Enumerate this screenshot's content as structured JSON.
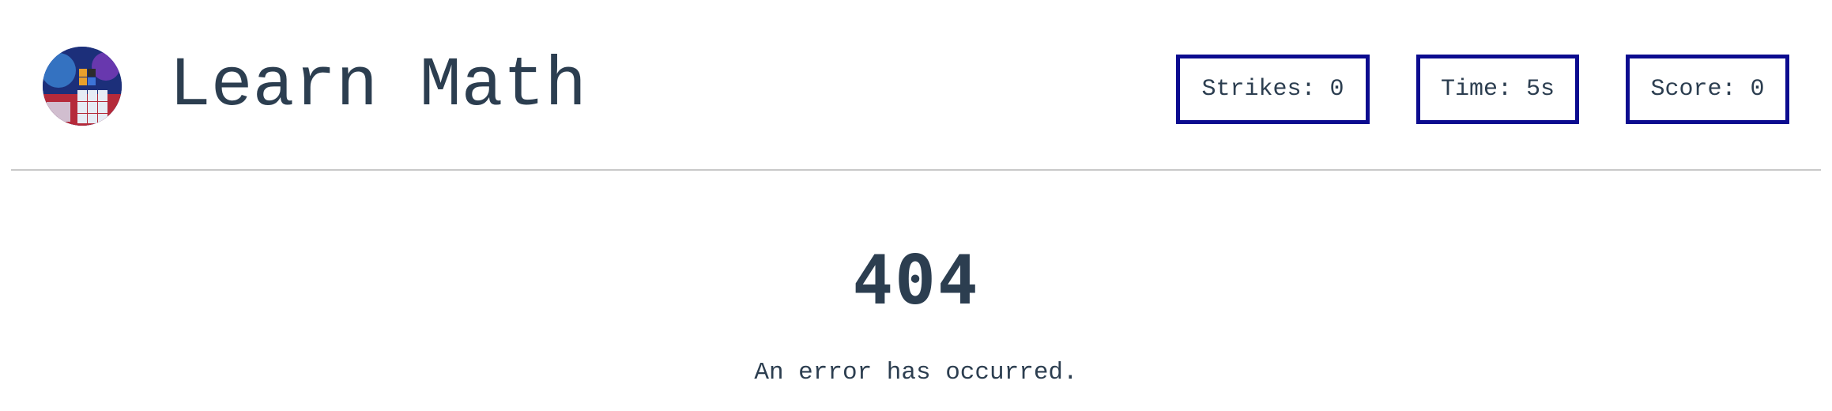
{
  "header": {
    "title": "Learn Math",
    "logo_alt": "Rubik's cube avatar"
  },
  "stats": {
    "strikes": "Strikes: 0",
    "time": "Time: 5s",
    "score": "Score: 0"
  },
  "error": {
    "code": "404",
    "message": "An error has occurred."
  },
  "colors": {
    "text": "#2c3e50",
    "stat_border": "#0b0b8f",
    "divider": "#c9c9c9",
    "background": "#ffffff"
  }
}
